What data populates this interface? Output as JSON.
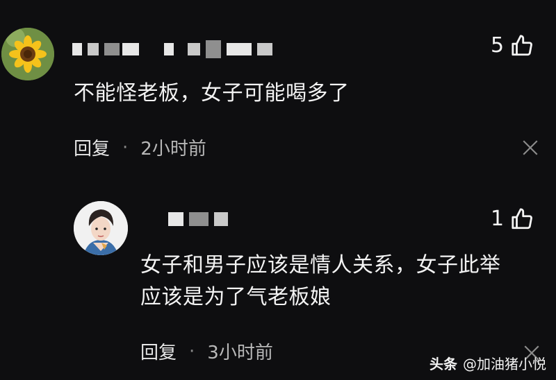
{
  "comments": [
    {
      "like_count": "5",
      "text_lines": [
        "不能怪老板，女子可能喝多了"
      ],
      "reply_label": "回复",
      "separator": "·",
      "time": "2小时前"
    },
    {
      "like_count": "1",
      "text_lines": [
        "女子和男子应该是情人关系，女子此举",
        "应该是为了气老板娘"
      ],
      "reply_label": "回复",
      "separator": "·",
      "time": "3小时前"
    }
  ],
  "watermark": {
    "brand": "头条",
    "account": "@加油猪小悦"
  },
  "icons": {
    "like": "thumbs-up-icon",
    "close": "close-icon",
    "avatar1": "sunflower-avatar",
    "avatar2": "cartoon-portrait-avatar"
  },
  "colors": {
    "background": "#0e0e10",
    "text": "#f3f3f3",
    "meta": "#b8b8b8"
  }
}
